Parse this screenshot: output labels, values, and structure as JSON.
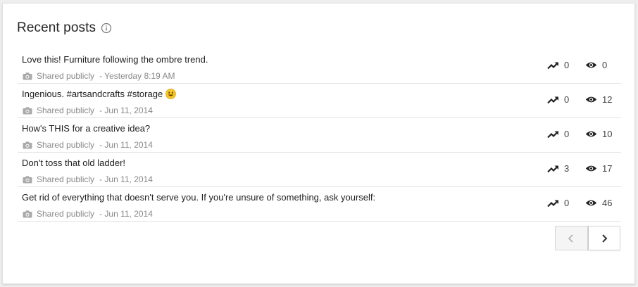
{
  "card": {
    "title": "Recent posts",
    "info_icon": "info-icon"
  },
  "posts": [
    {
      "text": "Love this! Furniture following the ombre trend.",
      "visibility": "Shared publicly",
      "date": "- Yesterday 8:19 AM",
      "trend": "0",
      "views": "0",
      "emoji": ""
    },
    {
      "text": "Ingenious. #artsandcrafts #storage",
      "visibility": "Shared publicly",
      "date": "- Jun 11, 2014",
      "trend": "0",
      "views": "12",
      "emoji": "smiley-emoji-icon"
    },
    {
      "text": "How's THIS for a creative idea?",
      "visibility": "Shared publicly",
      "date": "- Jun 11, 2014",
      "trend": "0",
      "views": "10",
      "emoji": ""
    },
    {
      "text": "Don't toss that old ladder!",
      "visibility": "Shared publicly",
      "date": "- Jun 11, 2014",
      "trend": "3",
      "views": "17",
      "emoji": ""
    },
    {
      "text": "Get rid of everything that doesn't serve you. If you're unsure of something, ask yourself:",
      "visibility": "Shared publicly",
      "date": "- Jun 11, 2014",
      "trend": "0",
      "views": "46",
      "emoji": ""
    }
  ],
  "icons": {
    "visibility": "camera-icon",
    "trend": "trending-up-icon",
    "views": "eye-icon",
    "prev": "chevron-left-icon",
    "next": "chevron-right-icon"
  },
  "colors": {
    "background": "#eeeeee",
    "card": "#ffffff",
    "meta_text": "#888888",
    "divider": "#e3e3e3"
  }
}
